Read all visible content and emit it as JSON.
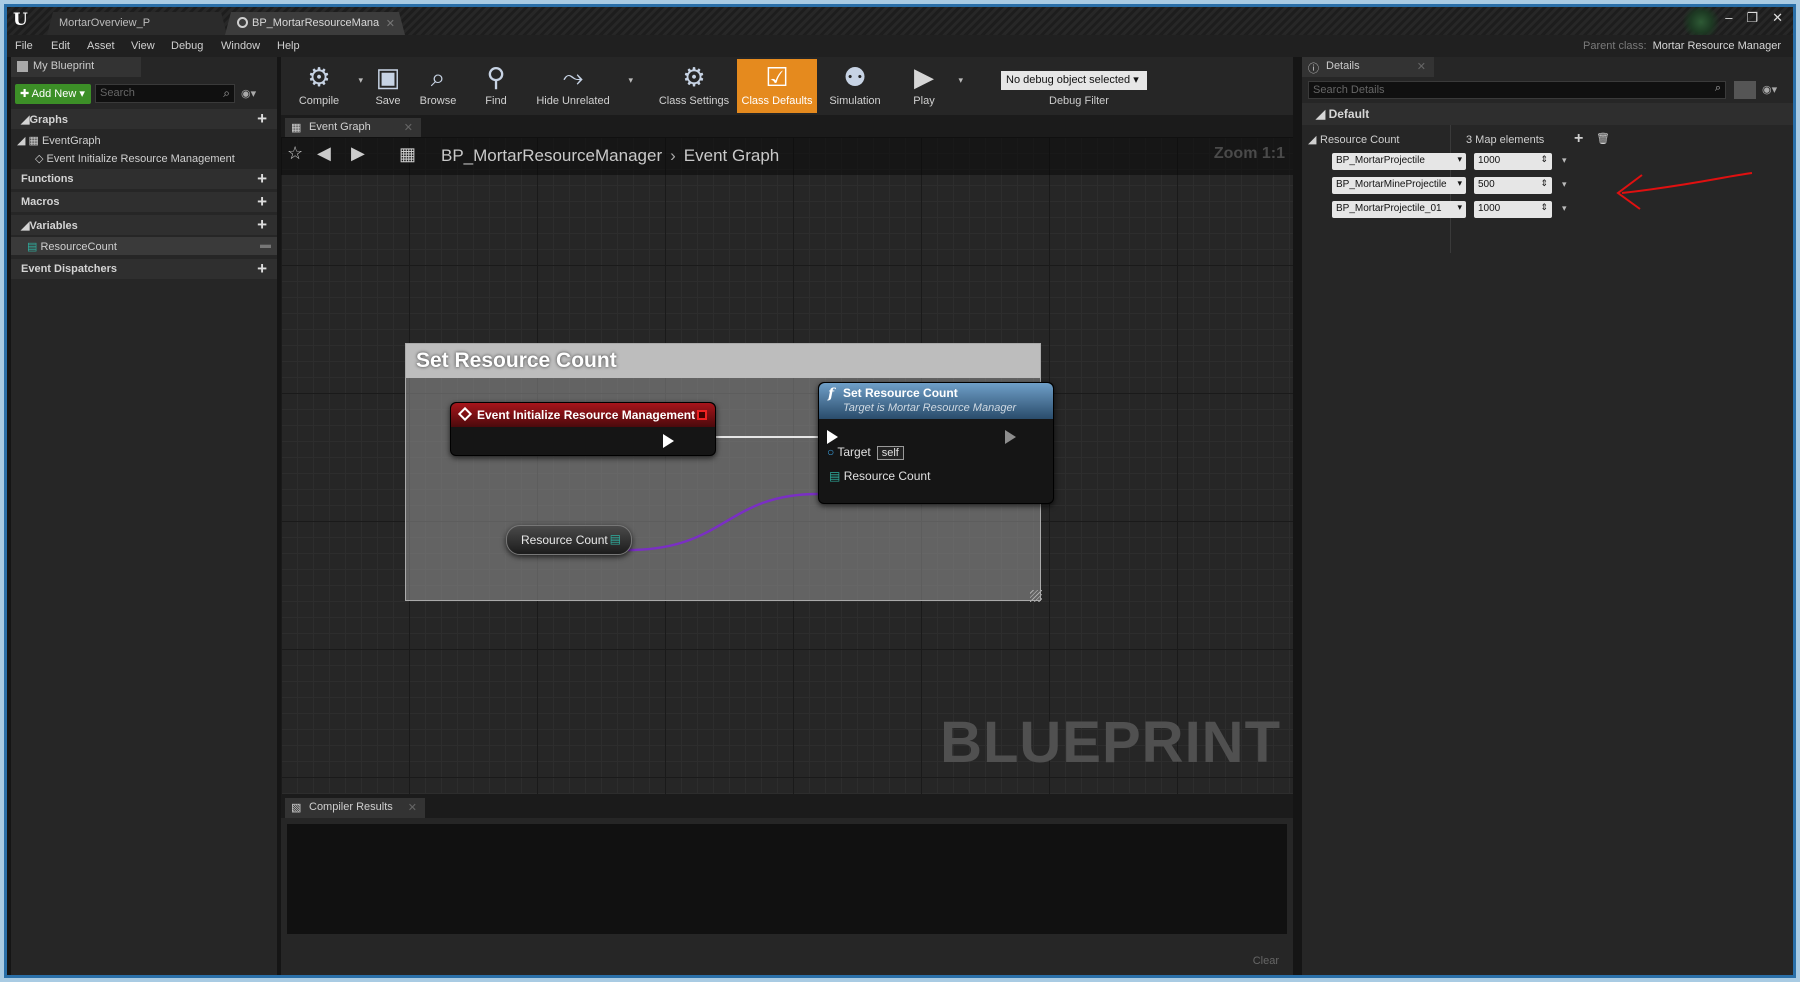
{
  "window": {
    "tabs": [
      "MortarOverview_P",
      "BP_MortarResourceMana"
    ],
    "controls": [
      "–",
      "❐",
      "✕"
    ]
  },
  "menu": {
    "items": [
      "File",
      "Edit",
      "Asset",
      "View",
      "Debug",
      "Window",
      "Help"
    ],
    "parent_class_label": "Parent class:",
    "parent_class_value": "Mortar Resource Manager"
  },
  "my_blueprint": {
    "tab": "My Blueprint",
    "add_new": "Add New",
    "search_placeholder": "Search",
    "graphs_header": "Graphs",
    "event_graph": "EventGraph",
    "event_item": "Event Initialize Resource Management",
    "functions_header": "Functions",
    "macros_header": "Macros",
    "variables_header": "Variables",
    "variable_item": "ResourceCount",
    "dispatchers_header": "Event Dispatchers"
  },
  "toolbar": {
    "compile": "Compile",
    "save": "Save",
    "browse": "Browse",
    "find": "Find",
    "hide_unrelated": "Hide Unrelated",
    "class_settings": "Class Settings",
    "class_defaults": "Class Defaults",
    "simulation": "Simulation",
    "play": "Play",
    "debug_object": "No debug object selected",
    "debug_filter": "Debug Filter"
  },
  "graph": {
    "tab": "Event Graph",
    "breadcrumb_root": "BP_MortarResourceManager",
    "breadcrumb_leaf": "Event Graph",
    "zoom": "Zoom 1:1",
    "watermark": "BLUEPRINT",
    "comment_title": "Set Resource Count",
    "event_node": "Event Initialize Resource Management",
    "func_node_title": "Set Resource Count",
    "func_node_subtitle": "Target is Mortar Resource Manager",
    "target_pin": "Target",
    "self_value": "self",
    "resource_pin": "Resource Count",
    "var_node": "Resource Count"
  },
  "compiler": {
    "tab": "Compiler Results",
    "clear": "Clear"
  },
  "details": {
    "tab": "Details",
    "search_placeholder": "Search Details",
    "section": "Default",
    "property": "Resource Count",
    "summary": "3 Map elements",
    "entries": [
      {
        "key": "BP_MortarProjectile",
        "value": "1000"
      },
      {
        "key": "BP_MortarMineProjectile",
        "value": "500"
      },
      {
        "key": "BP_MortarProjectile_01",
        "value": "1000"
      }
    ]
  },
  "colors": {
    "accent_orange": "#e58a1e",
    "event_red": "#a8151b",
    "function_blue": "#6f9fc8",
    "map_wire_purple": "#7a2fc4",
    "annotation_red": "#e01010",
    "add_new_green": "#3c8f27"
  }
}
